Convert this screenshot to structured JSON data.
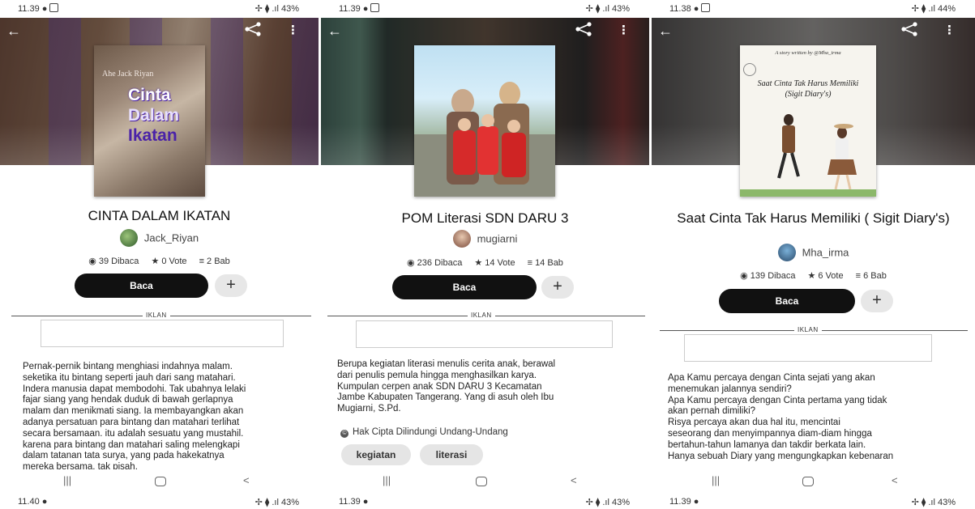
{
  "panels": [
    {
      "status": {
        "time": "11.39",
        "right": "✢ ⧫ .ıl 43%"
      },
      "title": "CINTA DALAM IKATAN",
      "cover_lines": [
        "Ahe Jack Riyan",
        "Cinta",
        "Dalam",
        "Ikatan"
      ],
      "author": "Jack_Riyan",
      "stats": {
        "reads": "39 Dibaca",
        "votes": "0 Vote",
        "chapters": "2 Bab"
      },
      "read_label": "Baca",
      "ad_label": "IKLAN",
      "description": "Pernak-pernik bintang menghiasi indahnya malam.\nseketika itu bintang seperti jauh dari sang matahari.\nIndera manusia dapat membodohi. Tak ubahnya lelaki\nfajar siang yang hendak duduk di bawah gerlapnya\nmalam dan menikmati siang. Ia membayangkan akan\nadanya persatuan para bintang dan matahari terlihat\nsecara bersamaan. itu adalah sesuatu yang mustahil.\nkarena para bintang dan matahari saling melengkapi\ndalam tatanan tata surya, yang pada hakekatnya\nmereka bersama, tak pisah.",
      "bottom": {
        "time": "11.40",
        "right": "✢ ⧫ .ıl 43%"
      }
    },
    {
      "status": {
        "time": "11.39",
        "right": "✢ ⧫ .ıl 43%"
      },
      "title": "POM Literasi SDN DARU 3",
      "author": "mugiarni",
      "stats": {
        "reads": "236 Dibaca",
        "votes": "14 Vote",
        "chapters": "14 Bab"
      },
      "read_label": "Baca",
      "ad_label": "IKLAN",
      "description": "Berupa kegiatan literasi menulis cerita anak, berawal\ndari penulis pemula hingga menghasilkan karya.\nKumpulan cerpen anak SDN DARU 3 Kecamatan\nJambe Kabupaten Tangerang. Yang di asuh oleh Ibu\nMugiarni, S.Pd.",
      "copyright": "Hak Cipta Dilindungi Undang-Undang",
      "tags": [
        "kegiatan",
        "literasi"
      ],
      "bottom": {
        "time": "11.39",
        "right": "✢ ⧫ .ıl 43%"
      }
    },
    {
      "status": {
        "time": "11.38",
        "right": "✢ ⧫ .ıl 44%"
      },
      "title": "Saat Cinta Tak Harus Memiliki ( Sigit Diary's)",
      "cover_lines": [
        "A story written by @Mha_irma",
        "Saat Cinta Tak Harus Memiliki",
        "(Sigit Diary's)"
      ],
      "author": "Mha_irma",
      "stats": {
        "reads": "139 Dibaca",
        "votes": "6 Vote",
        "chapters": "6 Bab"
      },
      "read_label": "Baca",
      "ad_label": "IKLAN",
      "description": "Apa Kamu percaya dengan Cinta sejati yang akan\nmenemukan jalannya sendiri?\nApa Kamu percaya dengan Cinta pertama yang tidak\nakan pernah dimiliki?\nRisya percaya akan dua hal itu, mencintai\nseseorang dan menyimpannya diam-diam hingga\nbertahun-tahun lamanya dan takdir berkata lain.\nHanya sebuah Diary yang mengungkapkan kebenaran",
      "bottom": {
        "time": "11.39",
        "right": "✢ ⧫ .ıl 43%"
      }
    }
  ],
  "icons": {
    "back": "←",
    "more": "⋮",
    "eye": "◉",
    "star": "★",
    "list": "≡",
    "add": "+",
    "nav_recent": "|||",
    "nav_back": "<"
  },
  "colors": {
    "cover_title_purple": "#4b23a8",
    "button_black": "#111111",
    "add_gray": "#e7e7e7"
  }
}
